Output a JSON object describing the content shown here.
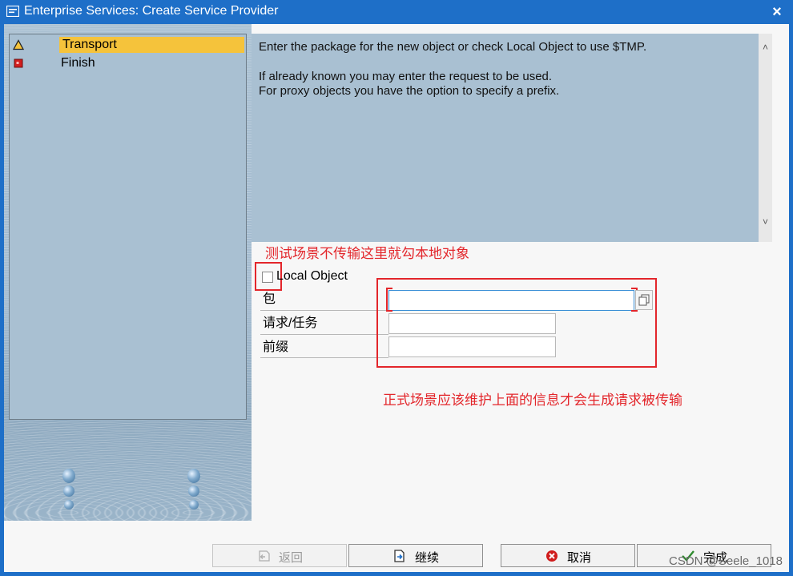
{
  "window": {
    "title": "Enterprise Services: Create Service Provider",
    "close_glyph": "×",
    "app_icon": "sap-window-icon"
  },
  "nav": {
    "items": [
      {
        "label": "Transport",
        "status_icon": "warning-triangle-icon",
        "status_color": "#f5c33b",
        "active": true
      },
      {
        "label": "Finish",
        "status_icon": "red-square-icon",
        "status_color": "#d21e1e",
        "active": false
      }
    ]
  },
  "info": {
    "line1": "Enter the package for the new object or check Local Object to use $TMP.",
    "line2": "If already known you may enter the request to be used.",
    "line3": "For proxy objects you have the option to specify a prefix."
  },
  "annotations": {
    "top_note": "测试场景不传输这里就勾本地对象",
    "bottom_note": "正式场景应该维护上面的信息才会生成请求被传输",
    "color": "#e3262b"
  },
  "form": {
    "local_object_label": "Local Object",
    "local_object_checked": false,
    "package_label": "包",
    "package_value": "",
    "request_label": "请求/任务",
    "request_value": "",
    "prefix_label": "前缀",
    "prefix_value": ""
  },
  "buttons": {
    "back": "返回",
    "continue": "继续",
    "cancel": "取消",
    "finish": "完成"
  },
  "watermark": "CSDN @Seele_1018",
  "colors": {
    "title_bar": "#1e6fc8",
    "panel_bg": "#a9c0d2",
    "highlight": "#f5c33b"
  }
}
